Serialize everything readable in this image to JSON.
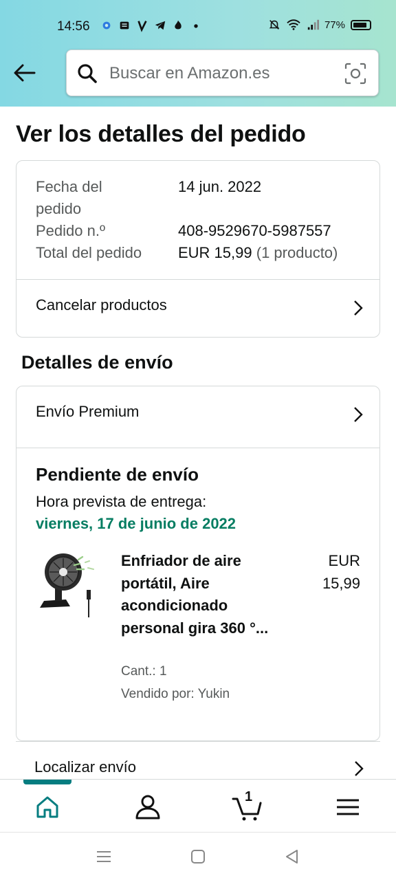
{
  "status_bar": {
    "time": "14:56",
    "battery": "77%",
    "left_icons": [
      "gear-icon",
      "message-icon",
      "v-app-icon",
      "telegram-icon",
      "flame-icon",
      "dot-icon"
    ],
    "right_icons": [
      "bell-muted-icon",
      "wifi-icon",
      "signal-icon",
      "battery-icon"
    ]
  },
  "search": {
    "placeholder": "Buscar en Amazon.es"
  },
  "page": {
    "title": "Ver los detalles del pedido"
  },
  "order": {
    "date_label_line1": "Fecha del",
    "date_label_line2": "pedido",
    "date_value": "14 jun. 2022",
    "number_label": "Pedido n.º",
    "number_value": "408-9529670-5987557",
    "total_label": "Total del pedido",
    "total_value": "EUR 15,99",
    "total_items": "(1 producto)",
    "cancel_label": "Cancelar productos"
  },
  "shipping": {
    "section_title": "Detalles de envío",
    "method": "Envío Premium",
    "status": "Pendiente de envío",
    "eta_label": "Hora prevista de entrega:",
    "eta_date": "viernes, 17 de junio de 2022",
    "product": {
      "title": "Enfriador de aire portátil, Aire acondicionado personal gira 360 °...",
      "price_currency": "EUR",
      "price_value": "15,99",
      "qty": "Cant.: 1",
      "seller": "Vendido por: Yukin"
    },
    "track_label": "Localizar envío"
  },
  "bottom_nav": {
    "items": [
      "home-icon",
      "account-icon",
      "cart-icon",
      "menu-icon"
    ],
    "cart_count": "1"
  },
  "colors": {
    "accent_teal": "#067d80",
    "delivery_green": "#067d62",
    "header_gradient_start": "#84d8e3",
    "header_gradient_end": "#a6e4cf"
  }
}
